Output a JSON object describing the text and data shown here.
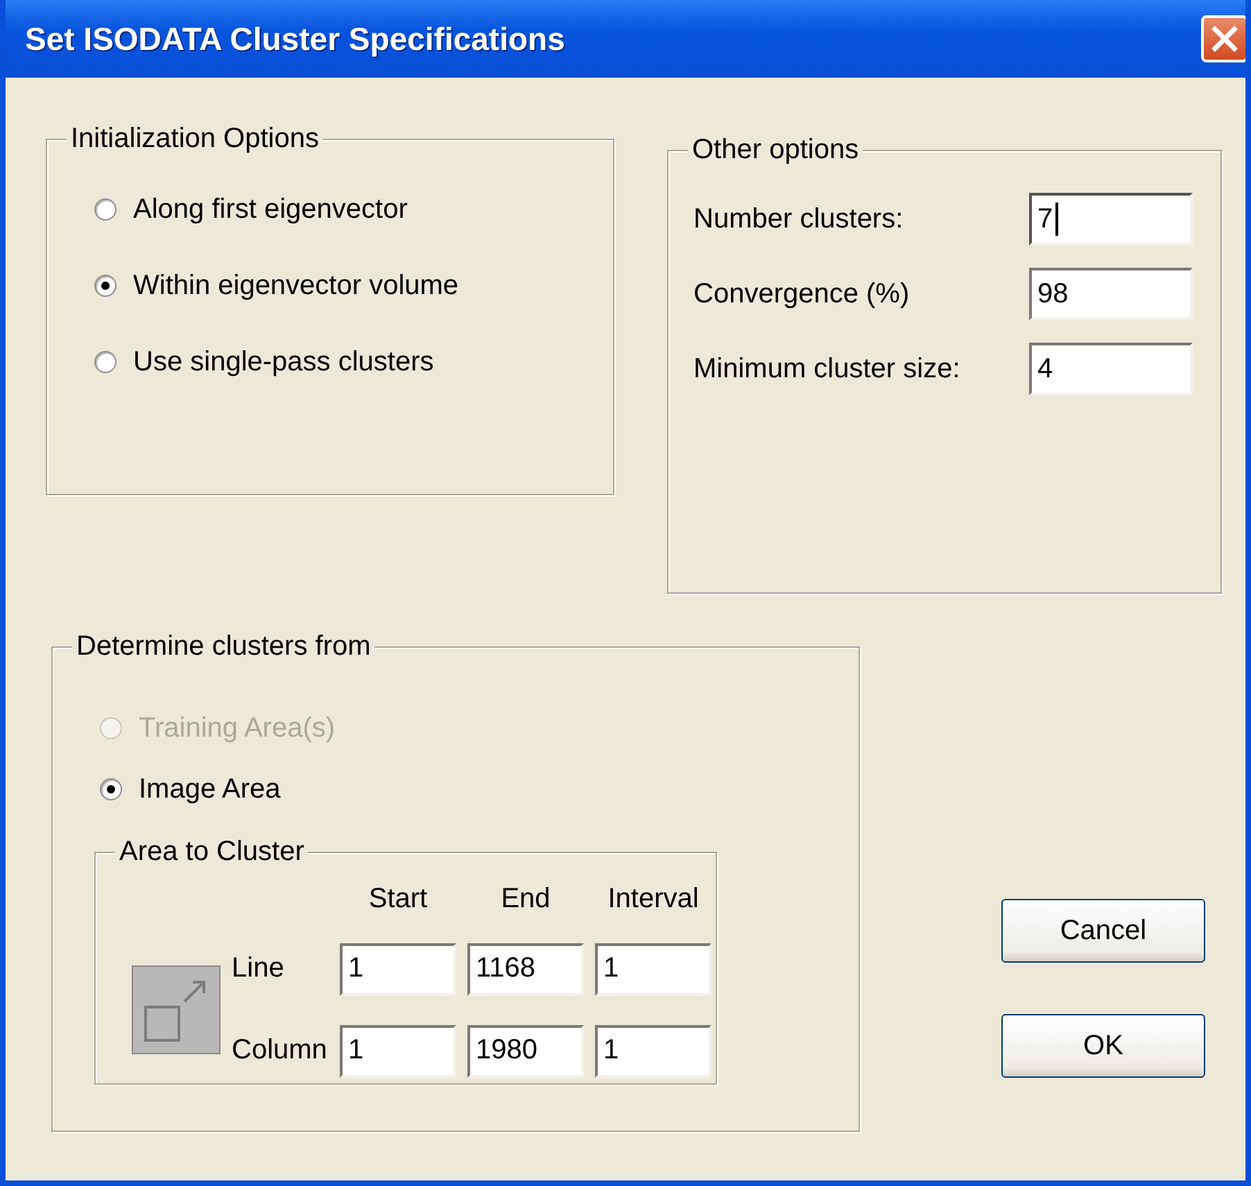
{
  "window": {
    "title": "Set ISODATA Cluster Specifications"
  },
  "initialization_options": {
    "title": "Initialization Options",
    "options": [
      {
        "label": "Along first eigenvector",
        "selected": false
      },
      {
        "label": "Within eigenvector volume",
        "selected": true
      },
      {
        "label": "Use single-pass clusters",
        "selected": false
      }
    ]
  },
  "other_options": {
    "title": "Other options",
    "fields": [
      {
        "label": "Number clusters:",
        "value": "7",
        "focused": true
      },
      {
        "label": "Convergence (%)",
        "value": "98",
        "focused": false
      },
      {
        "label": "Minimum cluster size:",
        "value": "4",
        "focused": false
      }
    ]
  },
  "determine_clusters_from": {
    "title": "Determine clusters from",
    "options": [
      {
        "label": "Training Area(s)",
        "selected": false,
        "disabled": true
      },
      {
        "label": "Image Area",
        "selected": true,
        "disabled": false
      }
    ],
    "area_to_cluster": {
      "title": "Area to Cluster",
      "columns": [
        "Start",
        "End",
        "Interval"
      ],
      "rows": [
        {
          "label": "Line",
          "values": [
            "1",
            "1168",
            "1"
          ]
        },
        {
          "label": "Column",
          "values": [
            "1",
            "1980",
            "1"
          ]
        }
      ]
    }
  },
  "buttons": [
    "Cancel",
    "OK"
  ]
}
